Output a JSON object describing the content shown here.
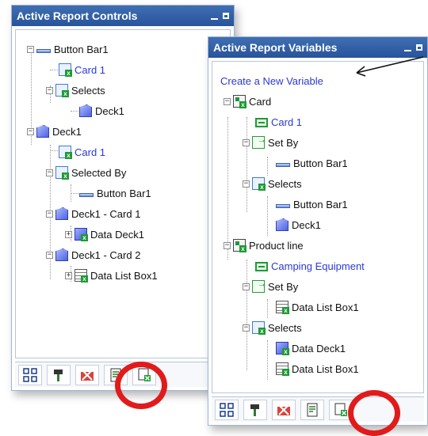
{
  "controls_panel": {
    "title": "Active Report Controls",
    "nodes": {
      "button_bar1": "Button Bar1",
      "card1": "Card 1",
      "selects": "Selects",
      "deck1_child": "Deck1",
      "deck1": "Deck1",
      "deck1_card1_link": "Card 1",
      "selected_by": "Selected By",
      "button_bar1_child": "Button Bar1",
      "deck1_card1": "Deck1 - Card 1",
      "data_deck1": "Data Deck1",
      "deck1_card2": "Deck1 - Card 2",
      "data_list_box1": "Data List Box1"
    }
  },
  "variables_panel": {
    "title": "Active Report Variables",
    "nodes": {
      "create_new": "Create a New Variable",
      "card": "Card",
      "card1": "Card 1",
      "set_by": "Set By",
      "button_bar1_a": "Button Bar1",
      "selects": "Selects",
      "button_bar1_b": "Button Bar1",
      "deck1": "Deck1",
      "product_line": "Product line",
      "camping": "Camping Equipment",
      "set_by2": "Set By",
      "data_list_box1_a": "Data List Box1",
      "selects2": "Selects",
      "data_deck1": "Data Deck1",
      "data_list_box1_b": "Data List Box1"
    }
  },
  "colors": {
    "title_bar": "#2f5fa8",
    "link": "#2a39d6",
    "highlight_circle": "#e11b1b"
  }
}
